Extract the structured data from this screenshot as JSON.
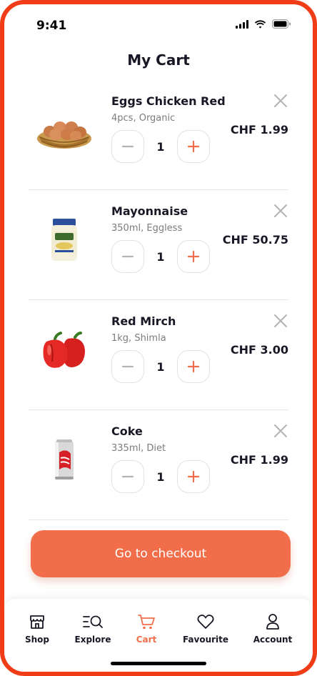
{
  "status": {
    "time": "9:41"
  },
  "header": {
    "title": "My Cart"
  },
  "items": [
    {
      "name": "Eggs Chicken Red",
      "desc": "4pcs, Organic",
      "qty": "1",
      "price": "CHF 1.99",
      "image": "eggs-basket-image"
    },
    {
      "name": "Mayonnaise",
      "desc": "350ml, Eggless",
      "qty": "1",
      "price": "CHF 50.75",
      "image": "mayonnaise-jar-image"
    },
    {
      "name": "Red Mirch",
      "desc": "1kg, Shimla",
      "qty": "1",
      "price": "CHF 3.00",
      "image": "red-peppers-image"
    },
    {
      "name": "Coke",
      "desc": "335ml, Diet",
      "qty": "1",
      "price": "CHF 1.99",
      "image": "coke-can-image"
    }
  ],
  "checkout": {
    "label": "Go to checkout"
  },
  "tabs": [
    {
      "label": "Shop",
      "icon": "store-icon"
    },
    {
      "label": "Explore",
      "icon": "explore-search-icon"
    },
    {
      "label": "Cart",
      "icon": "cart-icon",
      "active": true
    },
    {
      "label": "Favourite",
      "icon": "heart-icon"
    },
    {
      "label": "Account",
      "icon": "user-icon"
    }
  ],
  "colors": {
    "accent": "#F26E4A",
    "frame": "#F03C17",
    "text": "#181725",
    "muted": "#7C7C7C",
    "minus": "#B3B3B3"
  }
}
